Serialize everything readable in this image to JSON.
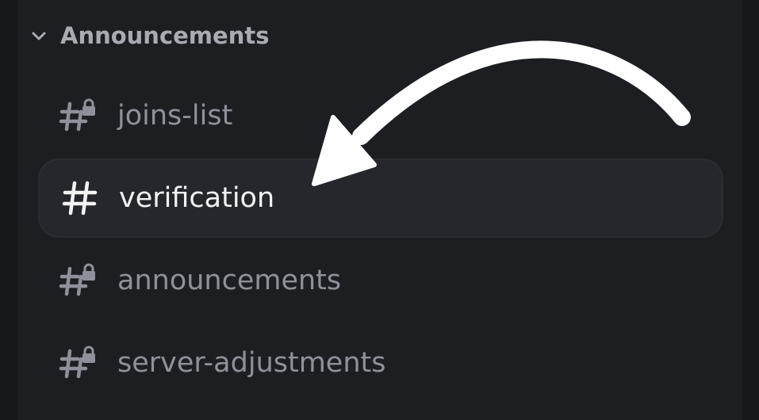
{
  "category": {
    "label": "Announcements",
    "icon": "chevron-down-icon"
  },
  "channels": [
    {
      "label": "joins-list",
      "icon": "locked-hash-icon",
      "locked": true,
      "active": false
    },
    {
      "label": "verification",
      "icon": "hash-icon",
      "locked": false,
      "active": true
    },
    {
      "label": "announcements",
      "icon": "locked-hash-icon",
      "locked": true,
      "active": false
    },
    {
      "label": "server-adjustments",
      "icon": "locked-hash-icon",
      "locked": true,
      "active": false
    }
  ],
  "colors": {
    "background": "#1d1e22",
    "active_row": "#26272d",
    "muted_text": "#8f919a",
    "active_text": "#f3f3f5",
    "arrow": "#ffffff"
  }
}
